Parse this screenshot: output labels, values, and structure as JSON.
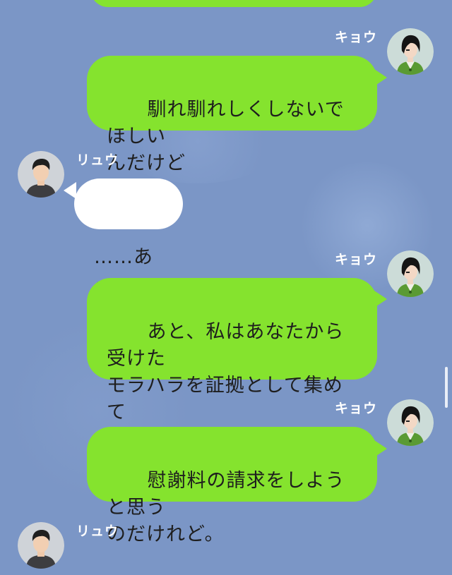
{
  "theme": {
    "background": "#7b96c6",
    "outgoing_bubble": "#85e32e",
    "incoming_bubble": "#ffffff",
    "name_color": "#ffffff"
  },
  "messages": [
    {
      "side": "right",
      "sender": "",
      "text": "",
      "avatar_icon": ""
    },
    {
      "side": "right",
      "sender": "キョウ",
      "text": "馴れ馴れしくしないでほしい\nんだけど",
      "avatar_icon": "woman-avatar-icon"
    },
    {
      "side": "left",
      "sender": "リュウ",
      "text": "……あっ",
      "avatar_icon": "man-avatar-icon"
    },
    {
      "side": "right",
      "sender": "キョウ",
      "text": "あと、私はあなたから受けた\nモラハラを証拠として集めて\nいるから",
      "avatar_icon": "woman-avatar-icon"
    },
    {
      "side": "right",
      "sender": "キョウ",
      "text": "慰謝料の請求をしようと思う\nのだけれど。",
      "avatar_icon": "woman-avatar-icon"
    },
    {
      "side": "left",
      "sender": "リュウ",
      "text": "",
      "avatar_icon": "man-avatar-icon"
    }
  ]
}
